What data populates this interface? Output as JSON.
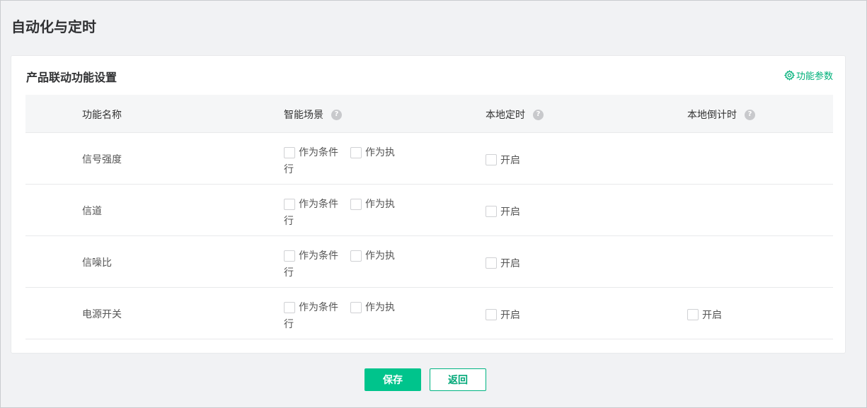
{
  "page": {
    "title": "自动化与定时"
  },
  "card": {
    "title": "产品联动功能设置",
    "params_link": "功能参数"
  },
  "table": {
    "headers": {
      "name": "功能名称",
      "scene": "智能场景",
      "local_timer": "本地定时",
      "local_countdown": "本地倒计时"
    },
    "help_glyph": "?",
    "scene_condition": "作为条件",
    "scene_action_part1": "作为执",
    "scene_action_part2": "行",
    "enable_label": "开启",
    "rows": [
      {
        "name": "信号强度",
        "has_countdown": false
      },
      {
        "name": "信道",
        "has_countdown": false
      },
      {
        "name": "信噪比",
        "has_countdown": false
      },
      {
        "name": "电源开关",
        "has_countdown": true
      }
    ]
  },
  "actions": {
    "save": "保存",
    "back": "返回"
  },
  "colors": {
    "accent": "#00c48c",
    "link": "#00b07a"
  }
}
